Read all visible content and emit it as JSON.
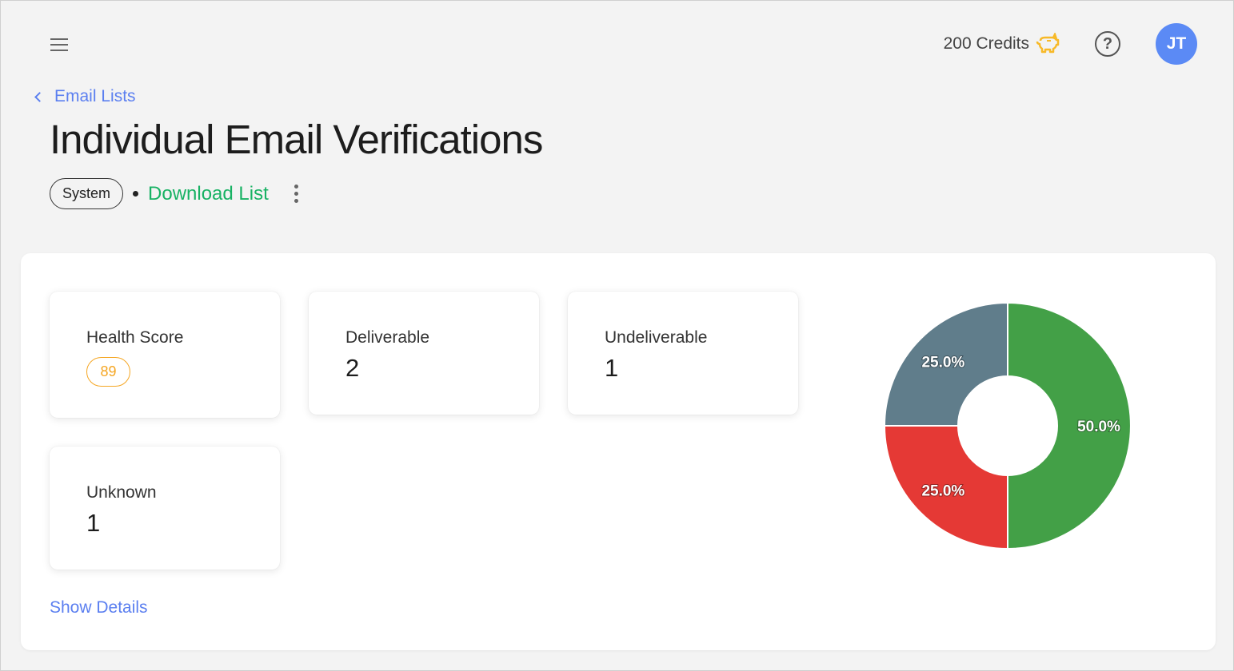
{
  "header": {
    "credits_label": "200 Credits",
    "credits_icon": "piggy-bank-icon",
    "help_icon": "question-circle-icon",
    "avatar_initials": "JT"
  },
  "breadcrumb": {
    "back_label": "Email Lists"
  },
  "page": {
    "title": "Individual Email Verifications",
    "tag": "System",
    "download_label": "Download List"
  },
  "stats": {
    "health_score": {
      "label": "Health Score",
      "value": "89"
    },
    "deliverable": {
      "label": "Deliverable",
      "value": "2"
    },
    "undeliverable": {
      "label": "Undeliverable",
      "value": "1"
    },
    "unknown": {
      "label": "Unknown",
      "value": "1"
    }
  },
  "show_details_label": "Show Details",
  "colors": {
    "accent": "#5b7ff0",
    "download": "#18b264",
    "score": "#f5a623",
    "avatar": "#5b8af5"
  },
  "chart_data": {
    "type": "pie",
    "donut": true,
    "title": "",
    "slices": [
      {
        "name": "Deliverable",
        "value": 2,
        "percent_label": "50.0%",
        "color": "#43a047"
      },
      {
        "name": "Undeliverable",
        "value": 1,
        "percent_label": "25.0%",
        "color": "#e53935"
      },
      {
        "name": "Unknown",
        "value": 1,
        "percent_label": "25.0%",
        "color": "#607d8b"
      }
    ]
  }
}
